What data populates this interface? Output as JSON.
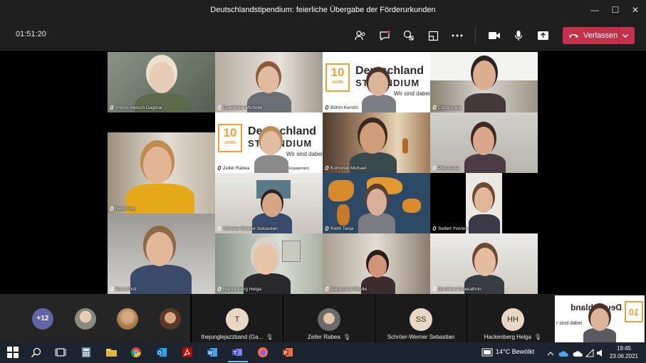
{
  "window": {
    "title": "Deutschlandstipendium: feierliche Übergabe der Förderurkunden",
    "minimize_glyph": "—",
    "maximize_glyph": "☐",
    "close_glyph": "✕"
  },
  "toolbar": {
    "timer": "01:51:20",
    "leave_label": "Verlassen",
    "icons": [
      "participants-icon",
      "chat-icon",
      "reactions-icon",
      "rooms-icon",
      "more-actions-icon",
      "camera-icon",
      "mic-icon",
      "share-icon",
      "phone-hangup-icon",
      "chevron-down-icon"
    ]
  },
  "tiles": [
    {
      "name": "Preiss-Allesch Dagmar"
    },
    {
      "name": "Goedecke Michelle"
    },
    {
      "name": "Böhm Kerstin"
    },
    {
      "name": "Ebner Lara"
    },
    {
      "name": "Zeller Rabea"
    },
    {
      "name": "Komorek Michael"
    },
    {
      "name": "Pols Lena"
    },
    {
      "name": "Nele Frey"
    },
    {
      "name": "Schröer-Werner Sebastian"
    },
    {
      "name": "Reith Tanja"
    },
    {
      "name": "Seifert Yvonne"
    },
    {
      "name": "Born Aristi"
    },
    {
      "name": "Hackenberg Helga"
    },
    {
      "name": "Baluschek Sibylle"
    },
    {
      "name": "Borchert Annekathrin"
    }
  ],
  "logo": {
    "ten": "10",
    "jahre": "JAHRE",
    "line1": "Deutschland",
    "line2": "STIPENDIUM",
    "line3": "Wir sind dabei",
    "line4": "Ihr Engagement,"
  },
  "strip": {
    "more_count": "+12",
    "participants": [
      {
        "initials": "T",
        "label": "thejunglejazzband (Ga...",
        "muted": true
      },
      {
        "initials": "",
        "label": "Zeller Rabea",
        "muted": true
      },
      {
        "initials": "SS",
        "label": "Schröer-Werner Sebastian",
        "muted": false
      },
      {
        "initials": "HH",
        "label": "Hackenberg Helga",
        "muted": true
      }
    ],
    "self_logo_ten": "10",
    "self_logo_text": "Deutschland",
    "self_logo_sub": "r sind dabei"
  },
  "taskbar": {
    "weather": "14°C  Bewölkt",
    "time": "19:45",
    "date": "23.06.2021",
    "mute_glyph": "✕"
  },
  "colors": {
    "leave": "#c4314b",
    "teams_purple": "#6264a7",
    "taskbar": "#1c2430"
  }
}
